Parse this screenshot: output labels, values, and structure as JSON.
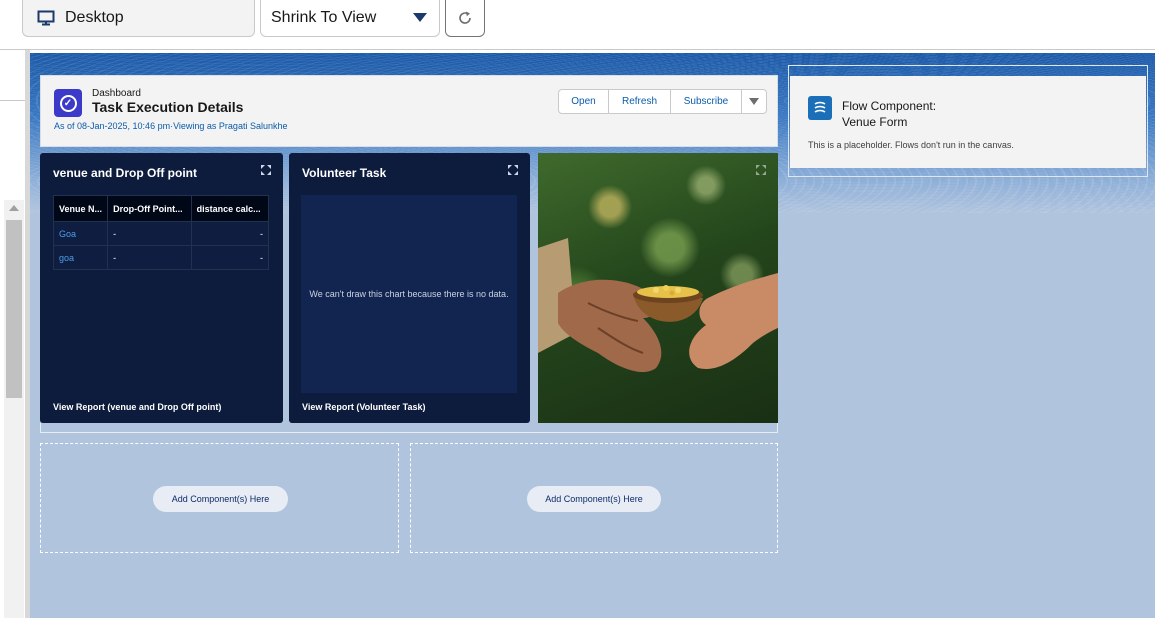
{
  "toolbar": {
    "device_label": "Desktop",
    "view_select": "Shrink To View"
  },
  "dashboard": {
    "label": "Dashboard",
    "title": "Task Execution Details",
    "meta": "As of 08-Jan-2025, 10:46 pm·Viewing as Pragati Salunkhe",
    "buttons": {
      "open": "Open",
      "refresh": "Refresh",
      "subscribe": "Subscribe"
    }
  },
  "cards": {
    "venue": {
      "title": "venue and Drop Off point",
      "columns": [
        "Venue N...",
        "Drop-Off Point...",
        "distance calc..."
      ],
      "rows": [
        [
          "Goa",
          "-",
          "-"
        ],
        [
          "goa",
          "-",
          "-"
        ]
      ],
      "footer": "View Report (venue and Drop Off point)"
    },
    "volunteer": {
      "title": "Volunteer Task",
      "empty": "We can't draw this chart because there is no data.",
      "footer": "View Report (Volunteer Task)"
    }
  },
  "drop_zones": {
    "left": "Add Component(s) Here",
    "right": "Add Component(s) Here"
  },
  "flow": {
    "title_line1": "Flow Component:",
    "title_line2": "Venue Form",
    "description": "This is a placeholder. Flows don't run in the canvas."
  },
  "colors": {
    "canvas": "#b0c4de",
    "card_bg": "#0d1b3d",
    "link": "#0b5cab",
    "dashboard_icon": "#3c3ac9",
    "flow_icon": "#1b6fb8"
  }
}
